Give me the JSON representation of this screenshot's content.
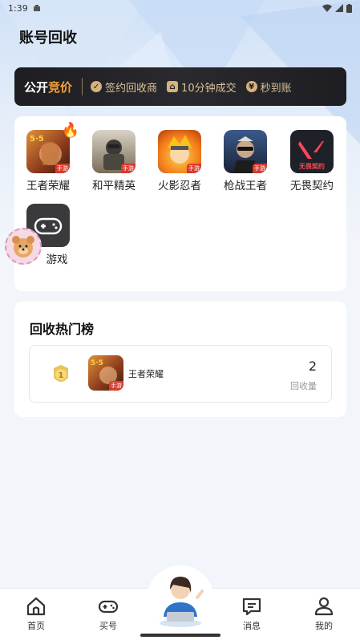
{
  "status_bar": {
    "time": "1:39"
  },
  "page_title": "账号回收",
  "banner": {
    "brand_prefix": "公开",
    "brand_highlight": "竞价",
    "features": [
      {
        "icon": "check-badge-icon",
        "label": "签约回收商"
      },
      {
        "icon": "bag-icon",
        "label": "10分钟成交"
      },
      {
        "icon": "money-bag-icon",
        "label": "秒到账"
      }
    ],
    "colors": {
      "background": "#1e1e22",
      "text": "#d9c19a",
      "accent": "#f6a23a"
    }
  },
  "games": [
    {
      "name": "王者荣耀",
      "icon": "honor-of-kings-icon",
      "hot": true,
      "tag": "手游"
    },
    {
      "name": "和平精英",
      "icon": "peacekeeper-elite-icon",
      "hot": false,
      "tag": "手游"
    },
    {
      "name": "火影忍者",
      "icon": "naruto-icon",
      "hot": false,
      "tag": "手游"
    },
    {
      "name": "枪战王者",
      "icon": "crossfire-icon",
      "hot": false,
      "tag": "手游"
    },
    {
      "name": "无畏契约",
      "icon": "valorant-icon",
      "hot": false,
      "tag": "无畏契约"
    },
    {
      "name": "游戏",
      "icon": "gamepad-icon",
      "hot": false,
      "tag": ""
    }
  ],
  "ranking": {
    "title": "回收热门榜",
    "rows": [
      {
        "rank": "1",
        "game": "王者荣耀",
        "count": "2",
        "count_label": "回收量"
      }
    ]
  },
  "tabbar": {
    "items": [
      {
        "label": "首页",
        "icon": "home-icon"
      },
      {
        "label": "买号",
        "icon": "gamepad-icon"
      },
      {
        "label": "消息",
        "icon": "message-icon"
      },
      {
        "label": "我的",
        "icon": "profile-icon"
      }
    ]
  }
}
